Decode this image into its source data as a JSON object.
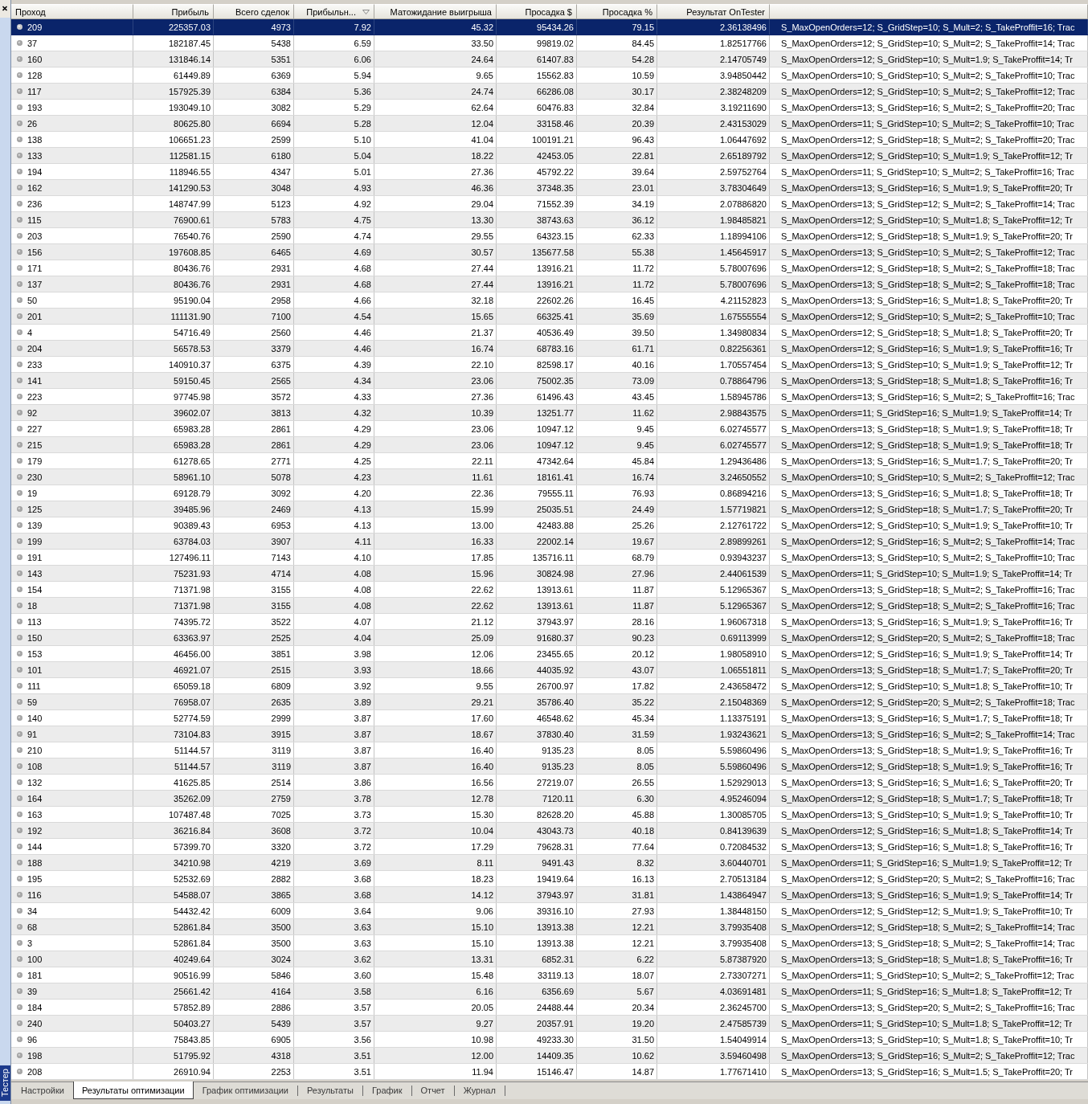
{
  "side_panel": {
    "label": "Тестер"
  },
  "columns": [
    {
      "label": "Проход",
      "sorted": false
    },
    {
      "label": "Прибыль",
      "sorted": false
    },
    {
      "label": "Всего сделок",
      "sorted": false
    },
    {
      "label": "Прибыльн...",
      "sorted": true
    },
    {
      "label": "Матожидание выигрыша",
      "sorted": false
    },
    {
      "label": "Просадка $",
      "sorted": false
    },
    {
      "label": "Просадка %",
      "sorted": false
    },
    {
      "label": "Результат OnTester",
      "sorted": false
    }
  ],
  "rows": [
    {
      "selected": true,
      "cells": [
        "209",
        "225357.03",
        "4973",
        "7.92",
        "45.32",
        "95434.26",
        "79.15",
        "2.36138496",
        "S_MaxOpenOrders=12; S_GridStep=10; S_Mult=2; S_TakeProffit=16; Trac"
      ]
    },
    {
      "selected": false,
      "cells": [
        "37",
        "182187.45",
        "5438",
        "6.59",
        "33.50",
        "99819.02",
        "84.45",
        "1.82517766",
        "S_MaxOpenOrders=12; S_GridStep=10; S_Mult=2; S_TakeProffit=14; Trac"
      ]
    },
    {
      "selected": false,
      "cells": [
        "160",
        "131846.14",
        "5351",
        "6.06",
        "24.64",
        "61407.83",
        "54.28",
        "2.14705749",
        "S_MaxOpenOrders=12; S_GridStep=10; S_Mult=1.9; S_TakeProffit=14; Tr"
      ]
    },
    {
      "selected": false,
      "cells": [
        "128",
        "61449.89",
        "6369",
        "5.94",
        "9.65",
        "15562.83",
        "10.59",
        "3.94850442",
        "S_MaxOpenOrders=10; S_GridStep=10; S_Mult=2; S_TakeProffit=10; Trac"
      ]
    },
    {
      "selected": false,
      "cells": [
        "117",
        "157925.39",
        "6384",
        "5.36",
        "24.74",
        "66286.08",
        "30.17",
        "2.38248209",
        "S_MaxOpenOrders=12; S_GridStep=10; S_Mult=2; S_TakeProffit=12; Trac"
      ]
    },
    {
      "selected": false,
      "cells": [
        "193",
        "193049.10",
        "3082",
        "5.29",
        "62.64",
        "60476.83",
        "32.84",
        "3.19211690",
        "S_MaxOpenOrders=13; S_GridStep=16; S_Mult=2; S_TakeProffit=20; Trac"
      ]
    },
    {
      "selected": false,
      "cells": [
        "26",
        "80625.80",
        "6694",
        "5.28",
        "12.04",
        "33158.46",
        "20.39",
        "2.43153029",
        "S_MaxOpenOrders=11; S_GridStep=10; S_Mult=2; S_TakeProffit=10; Trac"
      ]
    },
    {
      "selected": false,
      "cells": [
        "138",
        "106651.23",
        "2599",
        "5.10",
        "41.04",
        "100191.21",
        "96.43",
        "1.06447692",
        "S_MaxOpenOrders=12; S_GridStep=18; S_Mult=2; S_TakeProffit=20; Trac"
      ]
    },
    {
      "selected": false,
      "cells": [
        "133",
        "112581.15",
        "6180",
        "5.04",
        "18.22",
        "42453.05",
        "22.81",
        "2.65189792",
        "S_MaxOpenOrders=12; S_GridStep=10; S_Mult=1.9; S_TakeProffit=12; Tr"
      ]
    },
    {
      "selected": false,
      "cells": [
        "194",
        "118946.55",
        "4347",
        "5.01",
        "27.36",
        "45792.22",
        "39.64",
        "2.59752764",
        "S_MaxOpenOrders=11; S_GridStep=10; S_Mult=2; S_TakeProffit=16; Trac"
      ]
    },
    {
      "selected": false,
      "cells": [
        "162",
        "141290.53",
        "3048",
        "4.93",
        "46.36",
        "37348.35",
        "23.01",
        "3.78304649",
        "S_MaxOpenOrders=13; S_GridStep=16; S_Mult=1.9; S_TakeProffit=20; Tr"
      ]
    },
    {
      "selected": false,
      "cells": [
        "236",
        "148747.99",
        "5123",
        "4.92",
        "29.04",
        "71552.39",
        "34.19",
        "2.07886820",
        "S_MaxOpenOrders=13; S_GridStep=12; S_Mult=2; S_TakeProffit=14; Trac"
      ]
    },
    {
      "selected": false,
      "cells": [
        "115",
        "76900.61",
        "5783",
        "4.75",
        "13.30",
        "38743.63",
        "36.12",
        "1.98485821",
        "S_MaxOpenOrders=12; S_GridStep=10; S_Mult=1.8; S_TakeProffit=12; Tr"
      ]
    },
    {
      "selected": false,
      "cells": [
        "203",
        "76540.76",
        "2590",
        "4.74",
        "29.55",
        "64323.15",
        "62.33",
        "1.18994106",
        "S_MaxOpenOrders=12; S_GridStep=18; S_Mult=1.9; S_TakeProffit=20; Tr"
      ]
    },
    {
      "selected": false,
      "cells": [
        "156",
        "197608.85",
        "6465",
        "4.69",
        "30.57",
        "135677.58",
        "55.38",
        "1.45645917",
        "S_MaxOpenOrders=13; S_GridStep=10; S_Mult=2; S_TakeProffit=12; Trac"
      ]
    },
    {
      "selected": false,
      "cells": [
        "171",
        "80436.76",
        "2931",
        "4.68",
        "27.44",
        "13916.21",
        "11.72",
        "5.78007696",
        "S_MaxOpenOrders=12; S_GridStep=18; S_Mult=2; S_TakeProffit=18; Trac"
      ]
    },
    {
      "selected": false,
      "cells": [
        "137",
        "80436.76",
        "2931",
        "4.68",
        "27.44",
        "13916.21",
        "11.72",
        "5.78007696",
        "S_MaxOpenOrders=13; S_GridStep=18; S_Mult=2; S_TakeProffit=18; Trac"
      ]
    },
    {
      "selected": false,
      "cells": [
        "50",
        "95190.04",
        "2958",
        "4.66",
        "32.18",
        "22602.26",
        "16.45",
        "4.21152823",
        "S_MaxOpenOrders=13; S_GridStep=16; S_Mult=1.8; S_TakeProffit=20; Tr"
      ]
    },
    {
      "selected": false,
      "cells": [
        "201",
        "111131.90",
        "7100",
        "4.54",
        "15.65",
        "66325.41",
        "35.69",
        "1.67555554",
        "S_MaxOpenOrders=12; S_GridStep=10; S_Mult=2; S_TakeProffit=10; Trac"
      ]
    },
    {
      "selected": false,
      "cells": [
        "4",
        "54716.49",
        "2560",
        "4.46",
        "21.37",
        "40536.49",
        "39.50",
        "1.34980834",
        "S_MaxOpenOrders=12; S_GridStep=18; S_Mult=1.8; S_TakeProffit=20; Tr"
      ]
    },
    {
      "selected": false,
      "cells": [
        "204",
        "56578.53",
        "3379",
        "4.46",
        "16.74",
        "68783.16",
        "61.71",
        "0.82256361",
        "S_MaxOpenOrders=12; S_GridStep=16; S_Mult=1.9; S_TakeProffit=16; Tr"
      ]
    },
    {
      "selected": false,
      "cells": [
        "233",
        "140910.37",
        "6375",
        "4.39",
        "22.10",
        "82598.17",
        "40.16",
        "1.70557454",
        "S_MaxOpenOrders=13; S_GridStep=10; S_Mult=1.9; S_TakeProffit=12; Tr"
      ]
    },
    {
      "selected": false,
      "cells": [
        "141",
        "59150.45",
        "2565",
        "4.34",
        "23.06",
        "75002.35",
        "73.09",
        "0.78864796",
        "S_MaxOpenOrders=13; S_GridStep=18; S_Mult=1.8; S_TakeProffit=16; Tr"
      ]
    },
    {
      "selected": false,
      "cells": [
        "223",
        "97745.98",
        "3572",
        "4.33",
        "27.36",
        "61496.43",
        "43.45",
        "1.58945786",
        "S_MaxOpenOrders=13; S_GridStep=16; S_Mult=2; S_TakeProffit=16; Trac"
      ]
    },
    {
      "selected": false,
      "cells": [
        "92",
        "39602.07",
        "3813",
        "4.32",
        "10.39",
        "13251.77",
        "11.62",
        "2.98843575",
        "S_MaxOpenOrders=11; S_GridStep=16; S_Mult=1.9; S_TakeProffit=14; Tr"
      ]
    },
    {
      "selected": false,
      "cells": [
        "227",
        "65983.28",
        "2861",
        "4.29",
        "23.06",
        "10947.12",
        "9.45",
        "6.02745577",
        "S_MaxOpenOrders=13; S_GridStep=18; S_Mult=1.9; S_TakeProffit=18; Tr"
      ]
    },
    {
      "selected": false,
      "cells": [
        "215",
        "65983.28",
        "2861",
        "4.29",
        "23.06",
        "10947.12",
        "9.45",
        "6.02745577",
        "S_MaxOpenOrders=12; S_GridStep=18; S_Mult=1.9; S_TakeProffit=18; Tr"
      ]
    },
    {
      "selected": false,
      "cells": [
        "179",
        "61278.65",
        "2771",
        "4.25",
        "22.11",
        "47342.64",
        "45.84",
        "1.29436486",
        "S_MaxOpenOrders=13; S_GridStep=16; S_Mult=1.7; S_TakeProffit=20; Tr"
      ]
    },
    {
      "selected": false,
      "cells": [
        "230",
        "58961.10",
        "5078",
        "4.23",
        "11.61",
        "18161.41",
        "16.74",
        "3.24650552",
        "S_MaxOpenOrders=10; S_GridStep=10; S_Mult=2; S_TakeProffit=12; Trac"
      ]
    },
    {
      "selected": false,
      "cells": [
        "19",
        "69128.79",
        "3092",
        "4.20",
        "22.36",
        "79555.11",
        "76.93",
        "0.86894216",
        "S_MaxOpenOrders=13; S_GridStep=16; S_Mult=1.8; S_TakeProffit=18; Tr"
      ]
    },
    {
      "selected": false,
      "cells": [
        "125",
        "39485.96",
        "2469",
        "4.13",
        "15.99",
        "25035.51",
        "24.49",
        "1.57719821",
        "S_MaxOpenOrders=12; S_GridStep=18; S_Mult=1.7; S_TakeProffit=20; Tr"
      ]
    },
    {
      "selected": false,
      "cells": [
        "139",
        "90389.43",
        "6953",
        "4.13",
        "13.00",
        "42483.88",
        "25.26",
        "2.12761722",
        "S_MaxOpenOrders=12; S_GridStep=10; S_Mult=1.9; S_TakeProffit=10; Tr"
      ]
    },
    {
      "selected": false,
      "cells": [
        "199",
        "63784.03",
        "3907",
        "4.11",
        "16.33",
        "22002.14",
        "19.67",
        "2.89899261",
        "S_MaxOpenOrders=12; S_GridStep=16; S_Mult=2; S_TakeProffit=14; Trac"
      ]
    },
    {
      "selected": false,
      "cells": [
        "191",
        "127496.11",
        "7143",
        "4.10",
        "17.85",
        "135716.11",
        "68.79",
        "0.93943237",
        "S_MaxOpenOrders=13; S_GridStep=10; S_Mult=2; S_TakeProffit=10; Trac"
      ]
    },
    {
      "selected": false,
      "cells": [
        "143",
        "75231.93",
        "4714",
        "4.08",
        "15.96",
        "30824.98",
        "27.96",
        "2.44061539",
        "S_MaxOpenOrders=11; S_GridStep=10; S_Mult=1.9; S_TakeProffit=14; Tr"
      ]
    },
    {
      "selected": false,
      "cells": [
        "154",
        "71371.98",
        "3155",
        "4.08",
        "22.62",
        "13913.61",
        "11.87",
        "5.12965367",
        "S_MaxOpenOrders=13; S_GridStep=18; S_Mult=2; S_TakeProffit=16; Trac"
      ]
    },
    {
      "selected": false,
      "cells": [
        "18",
        "71371.98",
        "3155",
        "4.08",
        "22.62",
        "13913.61",
        "11.87",
        "5.12965367",
        "S_MaxOpenOrders=12; S_GridStep=18; S_Mult=2; S_TakeProffit=16; Trac"
      ]
    },
    {
      "selected": false,
      "cells": [
        "113",
        "74395.72",
        "3522",
        "4.07",
        "21.12",
        "37943.97",
        "28.16",
        "1.96067318",
        "S_MaxOpenOrders=13; S_GridStep=16; S_Mult=1.9; S_TakeProffit=16; Tr"
      ]
    },
    {
      "selected": false,
      "cells": [
        "150",
        "63363.97",
        "2525",
        "4.04",
        "25.09",
        "91680.37",
        "90.23",
        "0.69113999",
        "S_MaxOpenOrders=12; S_GridStep=20; S_Mult=2; S_TakeProffit=18; Trac"
      ]
    },
    {
      "selected": false,
      "cells": [
        "153",
        "46456.00",
        "3851",
        "3.98",
        "12.06",
        "23455.65",
        "20.12",
        "1.98058910",
        "S_MaxOpenOrders=12; S_GridStep=16; S_Mult=1.9; S_TakeProffit=14; Tr"
      ]
    },
    {
      "selected": false,
      "cells": [
        "101",
        "46921.07",
        "2515",
        "3.93",
        "18.66",
        "44035.92",
        "43.07",
        "1.06551811",
        "S_MaxOpenOrders=13; S_GridStep=18; S_Mult=1.7; S_TakeProffit=20; Tr"
      ]
    },
    {
      "selected": false,
      "cells": [
        "111",
        "65059.18",
        "6809",
        "3.92",
        "9.55",
        "26700.97",
        "17.82",
        "2.43658472",
        "S_MaxOpenOrders=12; S_GridStep=10; S_Mult=1.8; S_TakeProffit=10; Tr"
      ]
    },
    {
      "selected": false,
      "cells": [
        "59",
        "76958.07",
        "2635",
        "3.89",
        "29.21",
        "35786.40",
        "35.22",
        "2.15048369",
        "S_MaxOpenOrders=12; S_GridStep=20; S_Mult=2; S_TakeProffit=18; Trac"
      ]
    },
    {
      "selected": false,
      "cells": [
        "140",
        "52774.59",
        "2999",
        "3.87",
        "17.60",
        "46548.62",
        "45.34",
        "1.13375191",
        "S_MaxOpenOrders=13; S_GridStep=16; S_Mult=1.7; S_TakeProffit=18; Tr"
      ]
    },
    {
      "selected": false,
      "cells": [
        "91",
        "73104.83",
        "3915",
        "3.87",
        "18.67",
        "37830.40",
        "31.59",
        "1.93243621",
        "S_MaxOpenOrders=13; S_GridStep=16; S_Mult=2; S_TakeProffit=14; Trac"
      ]
    },
    {
      "selected": false,
      "cells": [
        "210",
        "51144.57",
        "3119",
        "3.87",
        "16.40",
        "9135.23",
        "8.05",
        "5.59860496",
        "S_MaxOpenOrders=13; S_GridStep=18; S_Mult=1.9; S_TakeProffit=16; Tr"
      ]
    },
    {
      "selected": false,
      "cells": [
        "108",
        "51144.57",
        "3119",
        "3.87",
        "16.40",
        "9135.23",
        "8.05",
        "5.59860496",
        "S_MaxOpenOrders=12; S_GridStep=18; S_Mult=1.9; S_TakeProffit=16; Tr"
      ]
    },
    {
      "selected": false,
      "cells": [
        "132",
        "41625.85",
        "2514",
        "3.86",
        "16.56",
        "27219.07",
        "26.55",
        "1.52929013",
        "S_MaxOpenOrders=13; S_GridStep=16; S_Mult=1.6; S_TakeProffit=20; Tr"
      ]
    },
    {
      "selected": false,
      "cells": [
        "164",
        "35262.09",
        "2759",
        "3.78",
        "12.78",
        "7120.11",
        "6.30",
        "4.95246094",
        "S_MaxOpenOrders=12; S_GridStep=18; S_Mult=1.7; S_TakeProffit=18; Tr"
      ]
    },
    {
      "selected": false,
      "cells": [
        "163",
        "107487.48",
        "7025",
        "3.73",
        "15.30",
        "82628.20",
        "45.88",
        "1.30085705",
        "S_MaxOpenOrders=13; S_GridStep=10; S_Mult=1.9; S_TakeProffit=10; Tr"
      ]
    },
    {
      "selected": false,
      "cells": [
        "192",
        "36216.84",
        "3608",
        "3.72",
        "10.04",
        "43043.73",
        "40.18",
        "0.84139639",
        "S_MaxOpenOrders=12; S_GridStep=16; S_Mult=1.8; S_TakeProffit=14; Tr"
      ]
    },
    {
      "selected": false,
      "cells": [
        "144",
        "57399.70",
        "3320",
        "3.72",
        "17.29",
        "79628.31",
        "77.64",
        "0.72084532",
        "S_MaxOpenOrders=13; S_GridStep=16; S_Mult=1.8; S_TakeProffit=16; Tr"
      ]
    },
    {
      "selected": false,
      "cells": [
        "188",
        "34210.98",
        "4219",
        "3.69",
        "8.11",
        "9491.43",
        "8.32",
        "3.60440701",
        "S_MaxOpenOrders=11; S_GridStep=16; S_Mult=1.9; S_TakeProffit=12; Tr"
      ]
    },
    {
      "selected": false,
      "cells": [
        "195",
        "52532.69",
        "2882",
        "3.68",
        "18.23",
        "19419.64",
        "16.13",
        "2.70513184",
        "S_MaxOpenOrders=12; S_GridStep=20; S_Mult=2; S_TakeProffit=16; Trac"
      ]
    },
    {
      "selected": false,
      "cells": [
        "116",
        "54588.07",
        "3865",
        "3.68",
        "14.12",
        "37943.97",
        "31.81",
        "1.43864947",
        "S_MaxOpenOrders=13; S_GridStep=16; S_Mult=1.9; S_TakeProffit=14; Tr"
      ]
    },
    {
      "selected": false,
      "cells": [
        "34",
        "54432.42",
        "6009",
        "3.64",
        "9.06",
        "39316.10",
        "27.93",
        "1.38448150",
        "S_MaxOpenOrders=12; S_GridStep=12; S_Mult=1.9; S_TakeProffit=10; Tr"
      ]
    },
    {
      "selected": false,
      "cells": [
        "68",
        "52861.84",
        "3500",
        "3.63",
        "15.10",
        "13913.38",
        "12.21",
        "3.79935408",
        "S_MaxOpenOrders=12; S_GridStep=18; S_Mult=2; S_TakeProffit=14; Trac"
      ]
    },
    {
      "selected": false,
      "cells": [
        "3",
        "52861.84",
        "3500",
        "3.63",
        "15.10",
        "13913.38",
        "12.21",
        "3.79935408",
        "S_MaxOpenOrders=13; S_GridStep=18; S_Mult=2; S_TakeProffit=14; Trac"
      ]
    },
    {
      "selected": false,
      "cells": [
        "100",
        "40249.64",
        "3024",
        "3.62",
        "13.31",
        "6852.31",
        "6.22",
        "5.87387920",
        "S_MaxOpenOrders=13; S_GridStep=18; S_Mult=1.8; S_TakeProffit=16; Tr"
      ]
    },
    {
      "selected": false,
      "cells": [
        "181",
        "90516.99",
        "5846",
        "3.60",
        "15.48",
        "33119.13",
        "18.07",
        "2.73307271",
        "S_MaxOpenOrders=11; S_GridStep=10; S_Mult=2; S_TakeProffit=12; Trac"
      ]
    },
    {
      "selected": false,
      "cells": [
        "39",
        "25661.42",
        "4164",
        "3.58",
        "6.16",
        "6356.69",
        "5.67",
        "4.03691481",
        "S_MaxOpenOrders=11; S_GridStep=16; S_Mult=1.8; S_TakeProffit=12; Tr"
      ]
    },
    {
      "selected": false,
      "cells": [
        "184",
        "57852.89",
        "2886",
        "3.57",
        "20.05",
        "24488.44",
        "20.34",
        "2.36245700",
        "S_MaxOpenOrders=13; S_GridStep=20; S_Mult=2; S_TakeProffit=16; Trac"
      ]
    },
    {
      "selected": false,
      "cells": [
        "240",
        "50403.27",
        "5439",
        "3.57",
        "9.27",
        "20357.91",
        "19.20",
        "2.47585739",
        "S_MaxOpenOrders=11; S_GridStep=10; S_Mult=1.8; S_TakeProffit=12; Tr"
      ]
    },
    {
      "selected": false,
      "cells": [
        "96",
        "75843.85",
        "6905",
        "3.56",
        "10.98",
        "49233.30",
        "31.50",
        "1.54049914",
        "S_MaxOpenOrders=13; S_GridStep=10; S_Mult=1.8; S_TakeProffit=10; Tr"
      ]
    },
    {
      "selected": false,
      "cells": [
        "198",
        "51795.92",
        "4318",
        "3.51",
        "12.00",
        "14409.35",
        "10.62",
        "3.59460498",
        "S_MaxOpenOrders=13; S_GridStep=16; S_Mult=2; S_TakeProffit=12; Trac"
      ]
    },
    {
      "selected": false,
      "cells": [
        "208",
        "26910.94",
        "2253",
        "3.51",
        "11.94",
        "15146.47",
        "14.87",
        "1.77671410",
        "S_MaxOpenOrders=13; S_GridStep=16; S_Mult=1.5; S_TakeProffit=20; Tr"
      ]
    }
  ],
  "tabs": [
    {
      "label": "Настройки",
      "selected": false
    },
    {
      "label": "Результаты оптимизации",
      "selected": true
    },
    {
      "label": "График оптимизации",
      "selected": false
    },
    {
      "label": "Результаты",
      "selected": false
    },
    {
      "label": "График",
      "selected": false
    },
    {
      "label": "Отчет",
      "selected": false
    },
    {
      "label": "Журнал",
      "selected": false
    }
  ]
}
